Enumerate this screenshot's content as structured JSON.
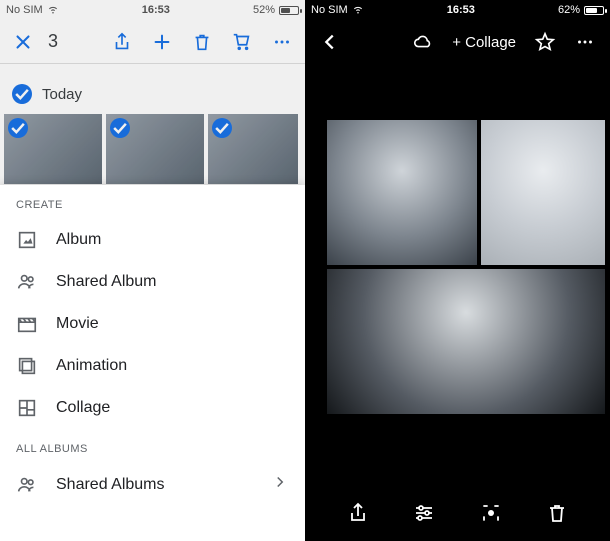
{
  "left": {
    "status": {
      "carrier": "No SIM",
      "time": "16:53",
      "battery_pct": "52%",
      "battery_fill_pct": 52
    },
    "toolbar": {
      "selected_count": "3"
    },
    "date_label": "Today",
    "sheet": {
      "create_label": "CREATE",
      "items": [
        {
          "label": "Album"
        },
        {
          "label": "Shared Album"
        },
        {
          "label": "Movie"
        },
        {
          "label": "Animation"
        },
        {
          "label": "Collage"
        }
      ],
      "all_albums_label": "ALL ALBUMS",
      "shared_albums_label": "Shared Albums"
    }
  },
  "right": {
    "status": {
      "carrier": "No SIM",
      "time": "16:53",
      "battery_pct": "62%",
      "battery_fill_pct": 62
    },
    "toolbar": {
      "collage_label": "+ Collage"
    }
  }
}
